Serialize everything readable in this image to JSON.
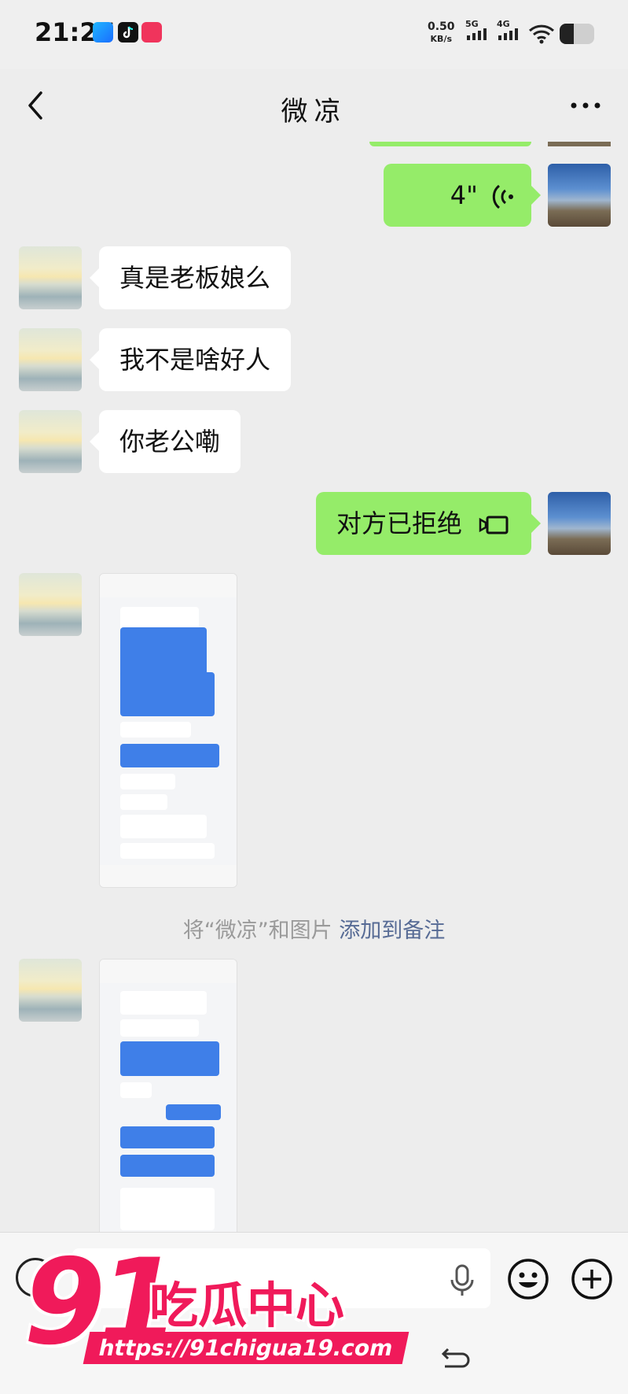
{
  "status_bar": {
    "time": "21:27",
    "speed_value": "0.50",
    "speed_unit": "KB/s",
    "net1": "5G",
    "net2": "4G",
    "app_icons": [
      "blue-app-icon",
      "tiktok-icon",
      "red-app-icon"
    ]
  },
  "header": {
    "title": "微凉",
    "back_icon": "chevron-left-icon",
    "more_icon": "more-dots-icon"
  },
  "messages": [
    {
      "side": "right",
      "type": "voice",
      "duration": "4\""
    },
    {
      "side": "left",
      "type": "text",
      "text": "真是老板娘么"
    },
    {
      "side": "left",
      "type": "text",
      "text": "我不是啥好人"
    },
    {
      "side": "left",
      "type": "text",
      "text": "你老公嘞"
    },
    {
      "side": "right",
      "type": "call",
      "text": "对方已拒绝"
    },
    {
      "side": "left",
      "type": "image"
    },
    {
      "side": "left",
      "type": "image"
    }
  ],
  "system_note": {
    "prefix": "将“微凉”和图片",
    "link": "添加到备注"
  },
  "input_bar": {
    "voice_icon": "voice-toggle-icon",
    "mic_icon": "microphone-icon",
    "emoji_icon": "emoji-icon",
    "plus_icon": "plus-icon",
    "nav_back_icon": "nav-back-icon"
  },
  "watermark": {
    "number": "91",
    "name": "吃瓜中心",
    "url": "https://91chigua19.com"
  },
  "colors": {
    "background": "#ededed",
    "self_bubble": "#95ec69",
    "other_bubble": "#ffffff",
    "link": "#576b95",
    "watermark": "#f01a5a"
  }
}
